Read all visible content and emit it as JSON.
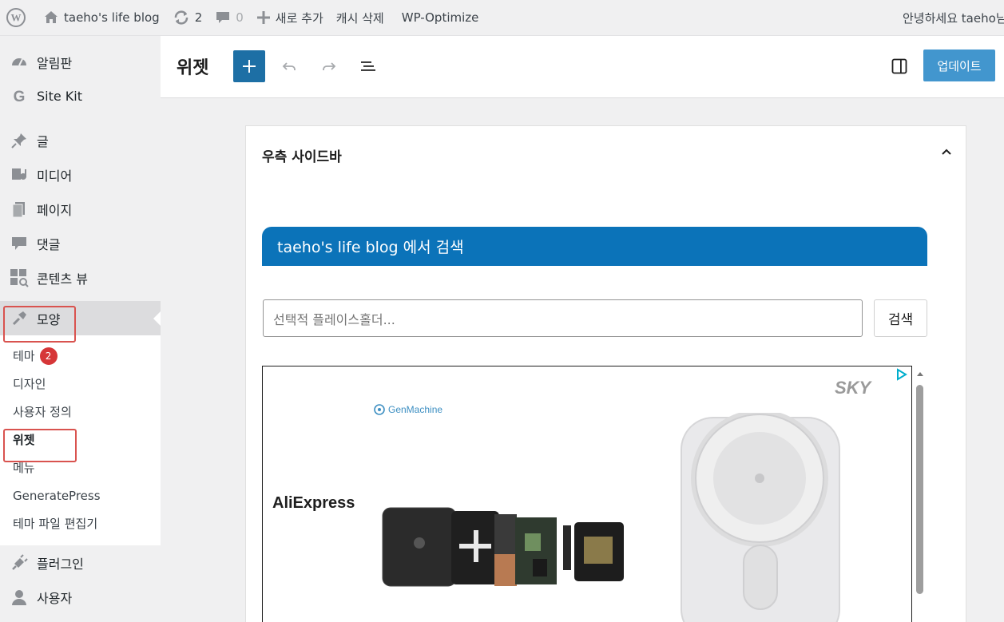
{
  "adminbar": {
    "site_name": "taeho's life blog",
    "updates_count": "2",
    "comments_count": "0",
    "new_label": "새로 추가",
    "cache_label": "캐시 삭제",
    "optimize_label": "WP-Optimize",
    "greeting": "안녕하세요 taeho님"
  },
  "sidebar": {
    "items": [
      {
        "label": "알림판",
        "icon": "dashboard-icon"
      },
      {
        "label": "Site Kit",
        "icon": "google-icon"
      },
      {
        "label": "글",
        "icon": "pin-icon"
      },
      {
        "label": "미디어",
        "icon": "media-icon"
      },
      {
        "label": "페이지",
        "icon": "page-icon"
      },
      {
        "label": "댓글",
        "icon": "comment-icon"
      },
      {
        "label": "콘텐츠 뷰",
        "icon": "content-views-icon"
      },
      {
        "label": "모양",
        "icon": "appearance-icon"
      }
    ],
    "submenu": [
      {
        "label": "테마",
        "badge": "2"
      },
      {
        "label": "디자인"
      },
      {
        "label": "사용자 정의"
      },
      {
        "label": "위젯"
      },
      {
        "label": "메뉴"
      },
      {
        "label": "GeneratePress"
      },
      {
        "label": "테마 파일 편집기"
      }
    ],
    "after": [
      {
        "label": "플러그인",
        "icon": "plugin-icon"
      },
      {
        "label": "사용자",
        "icon": "user-icon"
      }
    ]
  },
  "editor": {
    "title": "위젯",
    "update_label": "업데이트"
  },
  "panel": {
    "title": "우측 사이드바",
    "search_heading": "taeho's life blog 에서 검색",
    "search_placeholder": "선택적 플레이스홀더...",
    "search_button": "검색"
  },
  "ad": {
    "brand_left": "AliExpress",
    "brand_top": "GenMachine",
    "brand_right": "SKY"
  },
  "colors": {
    "accent": "#0b73b9",
    "update_button": "#2e8bc9",
    "badge": "#d63638",
    "highlight": "#d9534f"
  }
}
